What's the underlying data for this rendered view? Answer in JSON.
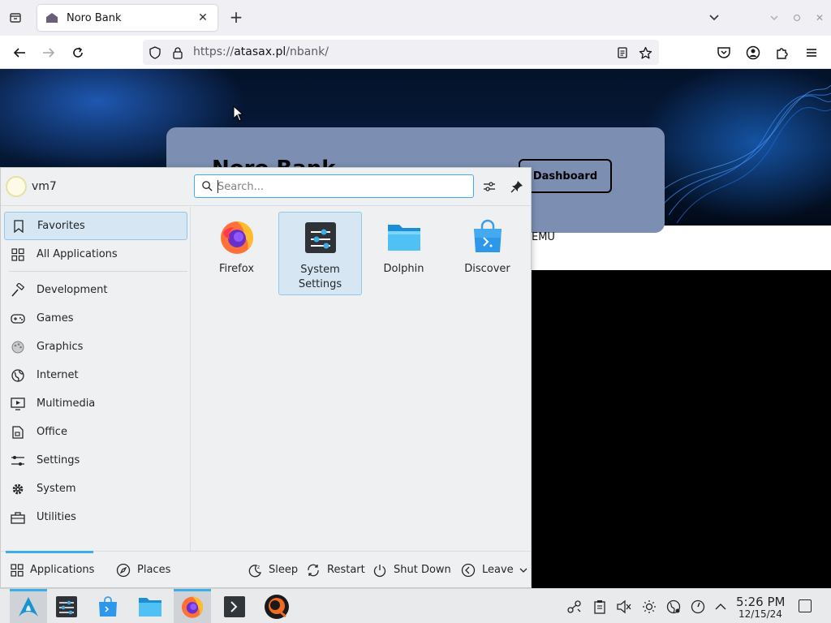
{
  "browser": {
    "tab_title": "Noro Bank",
    "url_scheme": "https://",
    "url_host": "atasax.pl",
    "url_path": "/nbank/"
  },
  "webpage": {
    "bank_name": "Noro Bank",
    "dashboard_button": "Dashboard",
    "emu_text": "EMU"
  },
  "launcher": {
    "username": "vm7",
    "search_placeholder": "Search...",
    "categories": [
      {
        "label": "Favorites",
        "icon": "bookmark-icon"
      },
      {
        "label": "All Applications",
        "icon": "grid-icon"
      },
      {
        "label": "Development",
        "icon": "hammer-icon"
      },
      {
        "label": "Games",
        "icon": "gamepad-icon"
      },
      {
        "label": "Graphics",
        "icon": "palette-icon"
      },
      {
        "label": "Internet",
        "icon": "globe-icon"
      },
      {
        "label": "Multimedia",
        "icon": "monitor-play-icon"
      },
      {
        "label": "Office",
        "icon": "document-icon"
      },
      {
        "label": "Settings",
        "icon": "sliders-icon"
      },
      {
        "label": "System",
        "icon": "gear-icon"
      },
      {
        "label": "Utilities",
        "icon": "toolbox-icon"
      }
    ],
    "apps": [
      {
        "label": "Firefox",
        "icon": "firefox-icon"
      },
      {
        "label": "System Settings",
        "icon": "system-settings-icon"
      },
      {
        "label": "Dolphin",
        "icon": "folder-icon"
      },
      {
        "label": "Discover",
        "icon": "store-bag-icon"
      }
    ],
    "footer": {
      "applications": "Applications",
      "places": "Places",
      "sleep": "Sleep",
      "restart": "Restart",
      "shutdown": "Shut Down",
      "leave": "Leave"
    }
  },
  "taskbar": {
    "time": "5:26 PM",
    "date": "12/15/24"
  },
  "colors": {
    "accent": "#3daee9",
    "selection": "#d6e6f2",
    "card": "#7c8fb3"
  }
}
